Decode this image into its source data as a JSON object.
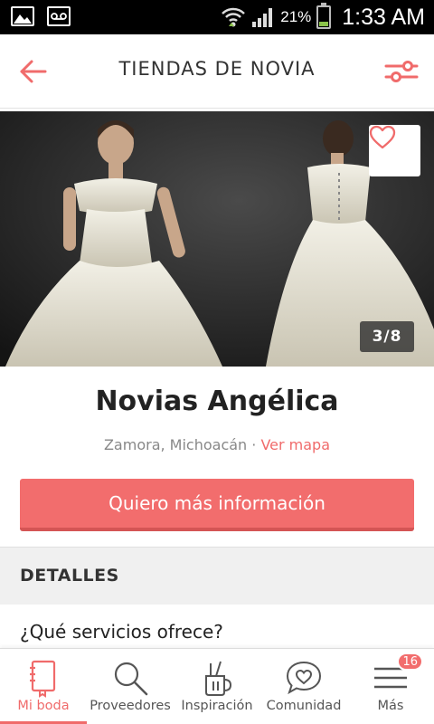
{
  "status_bar": {
    "battery_percent": "21%",
    "time": "1:33 AM",
    "battery_level": 0.21,
    "icons": [
      "image-notification-icon",
      "voicemail-icon",
      "wifi-icon",
      "signal-icon",
      "battery-icon"
    ]
  },
  "header": {
    "title": "TIENDAS DE NOVIA",
    "back_icon": "arrow-left-icon",
    "filter_icon": "sliders-icon"
  },
  "gallery": {
    "counter": "3/8",
    "favorite_icon": "heart-icon"
  },
  "shop": {
    "name": "Novias Angélica",
    "location": "Zamora, Michoacán",
    "separator": " · ",
    "map_link": "Ver mapa"
  },
  "cta": {
    "label": "Quiero más información"
  },
  "details": {
    "section_title": "DETALLES",
    "question": "¿Qué servicios ofrece?"
  },
  "bottom_nav": {
    "items": [
      {
        "label": "Mi boda",
        "icon": "notebook-icon",
        "active": true
      },
      {
        "label": "Proveedores",
        "icon": "search-icon",
        "active": false
      },
      {
        "label": "Inspiración",
        "icon": "pencil-cup-icon",
        "active": false
      },
      {
        "label": "Comunidad",
        "icon": "heart-chat-icon",
        "active": false
      },
      {
        "label": "Más",
        "icon": "menu-icon",
        "active": false,
        "badge": "16"
      }
    ]
  },
  "colors": {
    "accent": "#f26d6d",
    "accent_dark": "#d45555",
    "link": "#f06b6b"
  }
}
